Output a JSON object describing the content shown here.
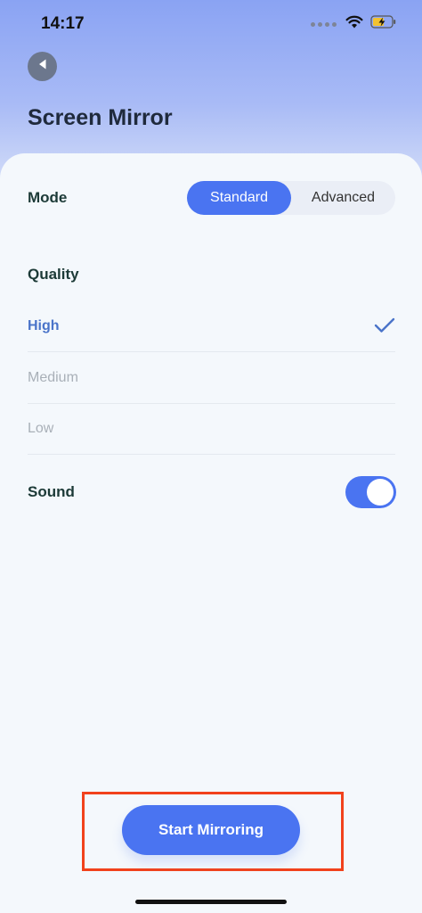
{
  "status_bar": {
    "time": "14:17"
  },
  "header": {
    "title": "Screen Mirror"
  },
  "mode": {
    "label": "Mode",
    "options": [
      "Standard",
      "Advanced"
    ],
    "selected": "Standard"
  },
  "quality": {
    "label": "Quality",
    "options": [
      "High",
      "Medium",
      "Low"
    ],
    "selected": "High"
  },
  "sound": {
    "label": "Sound",
    "enabled": true
  },
  "action": {
    "start_label": "Start Mirroring"
  },
  "colors": {
    "accent": "#4a74f1",
    "highlight": "#f1421c"
  },
  "icons": [
    "back-arrow-icon",
    "wifi-icon",
    "battery-charging-icon",
    "check-icon"
  ]
}
